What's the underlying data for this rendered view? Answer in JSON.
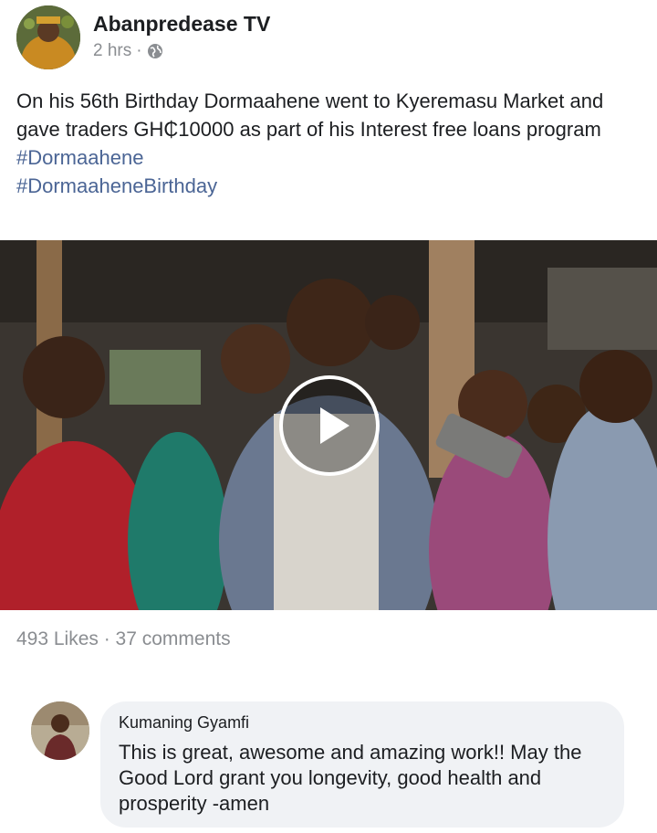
{
  "post": {
    "page_name": "Abanpredease TV",
    "time": "2 hrs",
    "separator": "·",
    "privacy_icon": "globe-icon",
    "text": "On his 56th Birthday Dormaahene went to Kyeremasu Market and gave traders GH₵10000 as part of his Interest free loans program",
    "hashtags": [
      "#Dormaahene",
      "#DormaaheneBirthday"
    ]
  },
  "video": {
    "play_icon": "play-icon"
  },
  "stats": {
    "text": "493 Likes · 37 comments"
  },
  "comment": {
    "author": "Kumaning Gyamfi",
    "text": "This is great, awesome and amazing work!! May the Good Lord grant you longevity, good health and prosperity -amen"
  },
  "colors": {
    "hashtag": "#4b6595",
    "meta_text": "#8a8d91",
    "comment_bubble": "#f0f2f5",
    "body_text": "#1c1e21"
  }
}
